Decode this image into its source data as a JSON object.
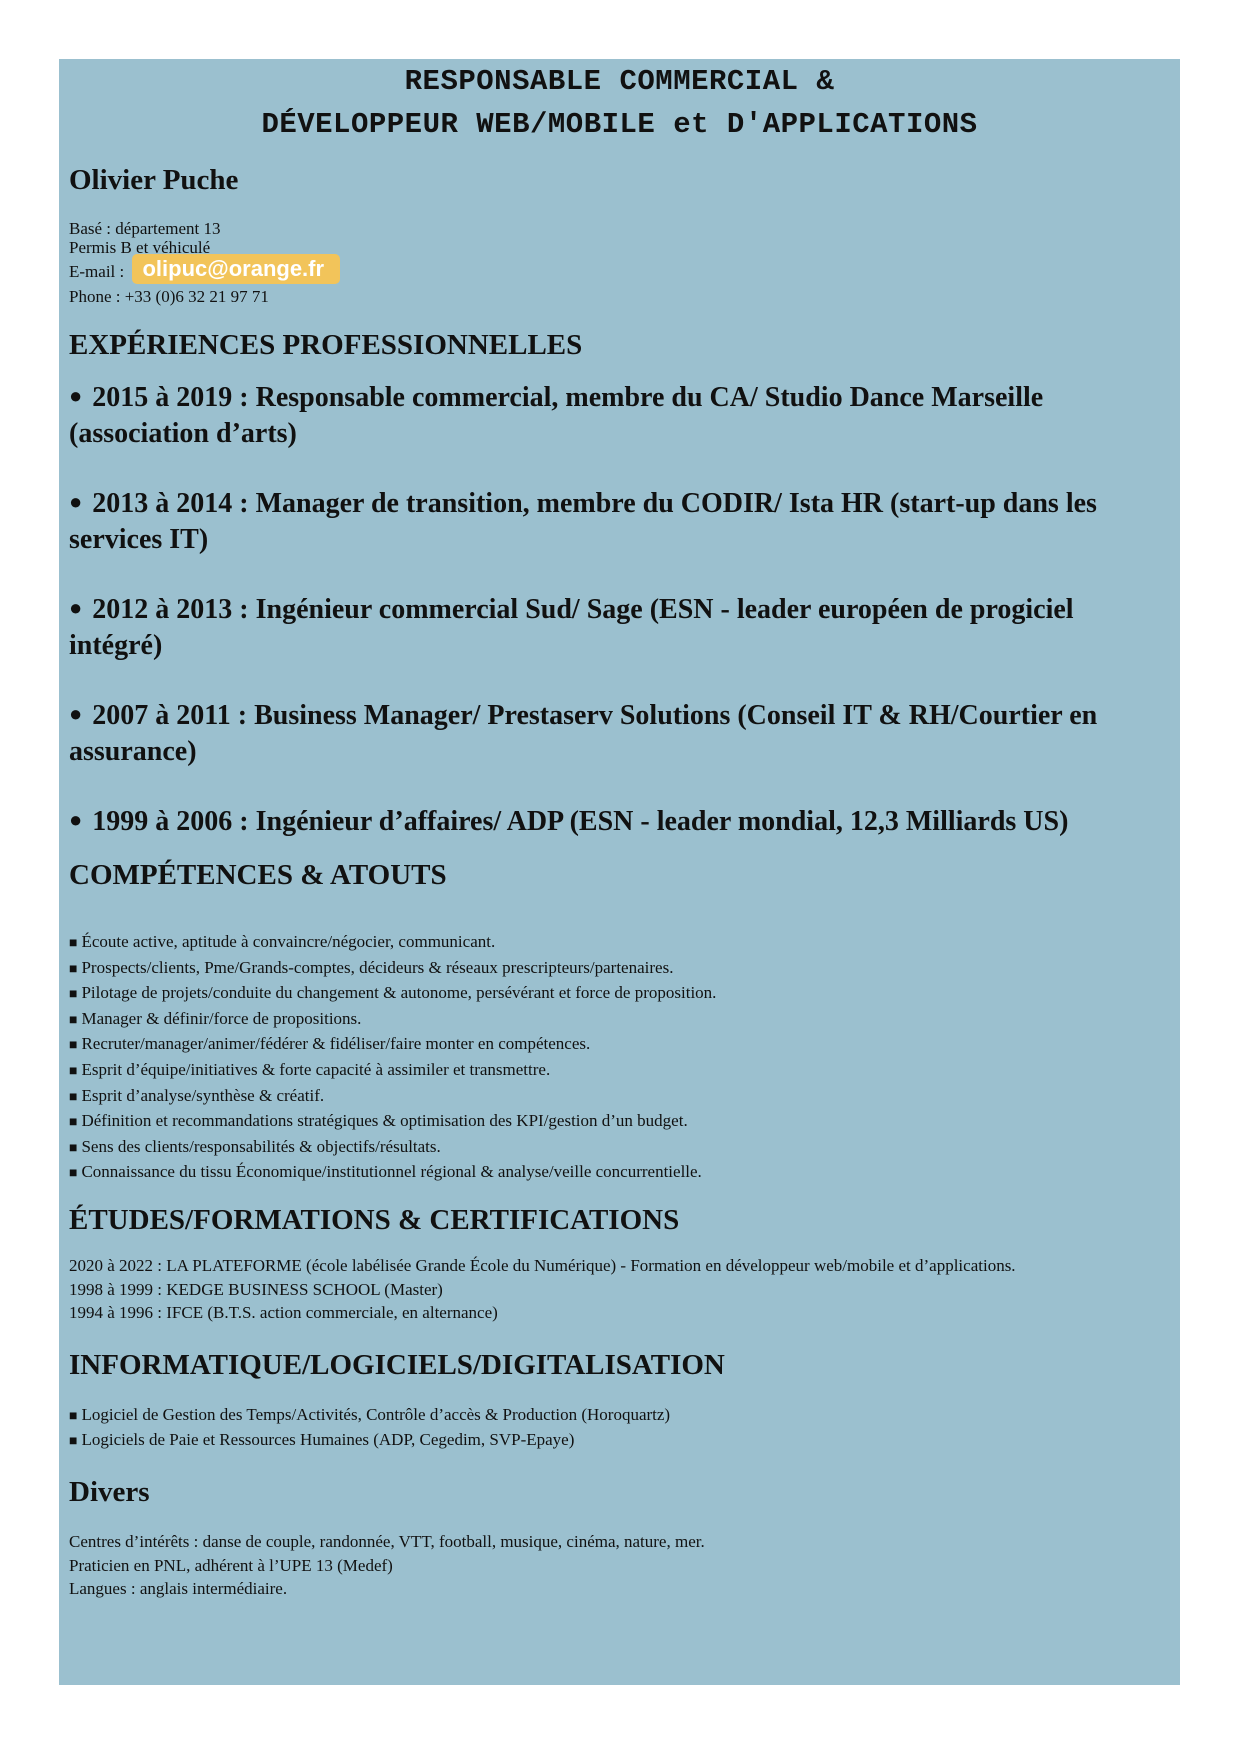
{
  "title": {
    "line1": "RESPONSABLE COMMERCIAL &",
    "line2": "DÉVELOPPEUR WEB/MOBILE et D'APPLICATIONS"
  },
  "name": "Olivier Puche",
  "contact": {
    "base": "Basé : département 13",
    "permis": "Permis B et véhiculé",
    "email_label": "E-mail :",
    "email": "olipuc@orange.fr",
    "phone": "Phone : +33 (0)6 32 21 97 71"
  },
  "experiences": {
    "heading": "EXPÉRIENCES PROFESSIONNELLES",
    "items": [
      "2015 à 2019 : Responsable commercial, membre du CA/ Studio Dance Marseille (association d’arts)",
      "2013 à 2014 : Manager de transition, membre du CODIR/ Ista HR (start-up dans les services IT)",
      "2012 à 2013 : Ingénieur commercial Sud/ Sage (ESN - leader européen de progiciel intégré)",
      "2007 à 2011 : Business Manager/ Prestaserv Solutions (Conseil IT & RH/Courtier en assurance)",
      "1999 à 2006 : Ingénieur d’affaires/ ADP (ESN - leader mondial, 12,3 Milliards US)"
    ]
  },
  "competences": {
    "heading": "COMPÉTENCES & ATOUTS",
    "items": [
      "Écoute active, aptitude à convaincre/négocier, communicant.",
      "Prospects/clients, Pme/Grands-comptes, décideurs & réseaux prescripteurs/partenaires.",
      "Pilotage de projets/conduite du changement & autonome, persévérant et force de proposition.",
      "Manager & définir/force de propositions.",
      "Recruter/manager/animer/fédérer & fidéliser/faire monter en compétences.",
      "Esprit d’équipe/initiatives & forte capacité à assimiler et transmettre.",
      "Esprit d’analyse/synthèse & créatif.",
      "Définition et recommandations stratégiques & optimisation des KPI/gestion d’un budget.",
      "Sens des clients/responsabilités & objectifs/résultats.",
      "Connaissance du tissu Économique/institutionnel régional & analyse/veille concurrentielle."
    ]
  },
  "etudes": {
    "heading": "ÉTUDES/FORMATIONS & CERTIFICATIONS",
    "items": [
      "2020 à 2022 : LA PLATEFORME (école labélisée Grande École du Numérique) - Formation en développeur web/mobile et d’applications.",
      "1998 à 1999 : KEDGE BUSINESS SCHOOL (Master)",
      "1994 à 1996 : IFCE (B.T.S. action commerciale, en alternance)"
    ]
  },
  "informatique": {
    "heading": "INFORMATIQUE/LOGICIELS/DIGITALISATION",
    "items": [
      "Logiciel de Gestion des Temps/Activités, Contrôle d’accès & Production (Horoquartz)",
      "Logiciels de Paie et Ressources Humaines (ADP, Cegedim, SVP-Epaye)"
    ]
  },
  "divers": {
    "heading": "Divers",
    "items": [
      "Centres d’intérêts : danse de couple, randonnée, VTT, football, musique, cinéma, nature, mer.",
      "Praticien en PNL, adhérent à l’UPE 13 (Medef)",
      "Langues : anglais intermédiaire."
    ]
  }
}
